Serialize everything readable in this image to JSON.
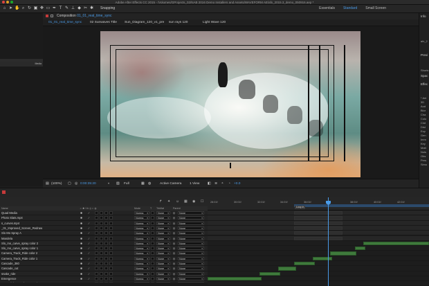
{
  "app": {
    "window_title": "Adobe After Effects CC 2015 - /Volumes/GProjects_02/NAB 2016 Demo Installers and Assets/WAVEFORM AE/afx_2015.3_demo_050916.aep *",
    "snapping_label": "Snapping",
    "workspaces": [
      "Essentials",
      "Standard",
      "Small Screen"
    ],
    "active_workspace": "Standard",
    "accent_color": "#4a9be8",
    "clip_color": "#3f7a3c"
  },
  "toolbar": {
    "tools": [
      "home-icon",
      "arrow-icon",
      "hand-icon",
      "zoom-icon",
      "rotate-icon",
      "camera-icon",
      "pan-behind-icon",
      "rectangle-icon",
      "pen-icon",
      "type-icon",
      "brush-icon",
      "clone-icon",
      "eraser-icon",
      "roto-icon",
      "puppet-icon"
    ]
  },
  "left_panel": {
    "media_header": "Media"
  },
  "composition": {
    "prefix": "Composition",
    "name": "01_01_real_time_sync",
    "tabs": [
      "01_01_real_time_sync",
      "02 Sunwaves Title",
      "Sun_Diagram_120_v1_pre",
      "sun rays 120",
      "Light Wave 120"
    ],
    "active_tab": "01_01_real_time_sync"
  },
  "viewer_bar": {
    "zoom": "(100%)",
    "timecode": "0:00:35:20",
    "resolution": "Full",
    "camera": "Active Camera",
    "views": "1 View",
    "exposure": "+0.0"
  },
  "right_panel": {
    "info_label": "Info",
    "file_text": "afx_2",
    "preview_label": "Previ",
    "shortcut_label": "Shortc",
    "space_label": "Spac",
    "effects_label": "Effec",
    "items": [
      "* Ani",
      "3D",
      "Aud",
      "Blur",
      "Cha",
      "Colo",
      "Cint",
      "Dist",
      "Exp",
      "Gen",
      "Imm",
      "Key",
      "Matt",
      "Nois",
      "Obs",
      "Pers",
      "Simu"
    ]
  },
  "timeline": {
    "columns": {
      "name": "Name",
      "mode": "Mode",
      "t": "T",
      "trkmat": "TrkMat",
      "parent": "Parent"
    },
    "ruler_ticks": [
      "28:01f",
      "30:01f",
      "32:01f",
      "34:01f",
      "36:01f",
      "38:01f",
      "40:01f",
      "42:01f"
    ],
    "marker_label": "Loop in",
    "layers": [
      {
        "name": "Quad Media",
        "mode": "Norma",
        "trkmat": "None",
        "parent": "None"
      },
      {
        "name": "Photo Slats.mp4",
        "mode": "Norma",
        "trkmat": "None",
        "parent": "None"
      },
      {
        "name": "s_curves.mp4",
        "mode": "Norma",
        "trkmat": "None",
        "parent": "None"
      },
      {
        "name": "_01_Improved_Screen_Redraw",
        "mode": "Norma",
        "trkmat": "None",
        "parent": "None"
      },
      {
        "name": "Slo Mo Spray A",
        "mode": "Norma",
        "trkmat": "None",
        "parent": "None"
      },
      {
        "name": "Mandela",
        "mode": "Norma",
        "trkmat": "None",
        "parent": "None"
      },
      {
        "name": "Slo_mo_carve_spray color 2",
        "mode": "Norma",
        "trkmat": "None",
        "parent": "None"
      },
      {
        "name": "Slo_mo_carve_spray color 1",
        "mode": "Norma",
        "trkmat": "None",
        "parent": "None"
      },
      {
        "name": "Camera_Track_Ride color 2",
        "mode": "Norma",
        "trkmat": "None",
        "parent": "None"
      },
      {
        "name": "Camera_Track_Ride color 1",
        "mode": "Norma",
        "trkmat": "None",
        "parent": "None"
      },
      {
        "name": "Cascade_360",
        "mode": "Norma",
        "trkmat": "None",
        "parent": "None"
      },
      {
        "name": "Cascade_cut",
        "mode": "Norma",
        "trkmat": "None",
        "parent": "None"
      },
      {
        "name": "snake_ride",
        "mode": "Norma",
        "trkmat": "None",
        "parent": "None"
      },
      {
        "name": "Emergence",
        "mode": "Norma",
        "trkmat": "None",
        "parent": "None"
      },
      {
        "name": "_01_Adobe_Stock_Integration",
        "mode": "Norma",
        "trkmat": "None",
        "parent": "None"
      }
    ]
  }
}
